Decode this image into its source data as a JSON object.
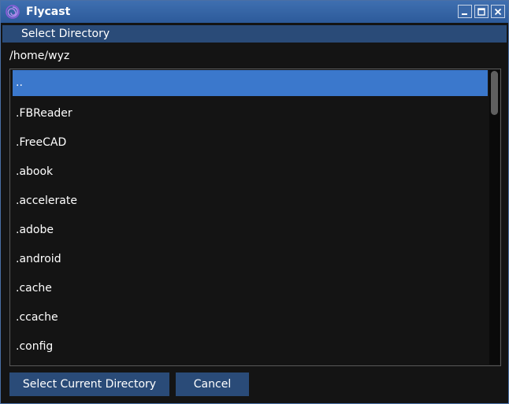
{
  "window": {
    "title": "Flycast",
    "controls": [
      "minimize-icon",
      "maximize-icon",
      "close-icon"
    ]
  },
  "dialog": {
    "title": "Select Directory",
    "current_path": "/home/wyz",
    "entries": [
      {
        "label": "..",
        "selected": true
      },
      {
        "label": ".FBReader",
        "selected": false
      },
      {
        "label": ".FreeCAD",
        "selected": false
      },
      {
        "label": ".abook",
        "selected": false
      },
      {
        "label": ".accelerate",
        "selected": false
      },
      {
        "label": ".adobe",
        "selected": false
      },
      {
        "label": ".android",
        "selected": false
      },
      {
        "label": ".cache",
        "selected": false
      },
      {
        "label": ".ccache",
        "selected": false
      },
      {
        "label": ".config",
        "selected": false
      }
    ],
    "buttons": {
      "select_label": "Select Current Directory",
      "cancel_label": "Cancel"
    }
  },
  "colors": {
    "titlebar": "#3f6fb0",
    "header": "#2a4b78",
    "selection": "#3b78cc",
    "background": "#141414",
    "button": "#2a4b78"
  }
}
